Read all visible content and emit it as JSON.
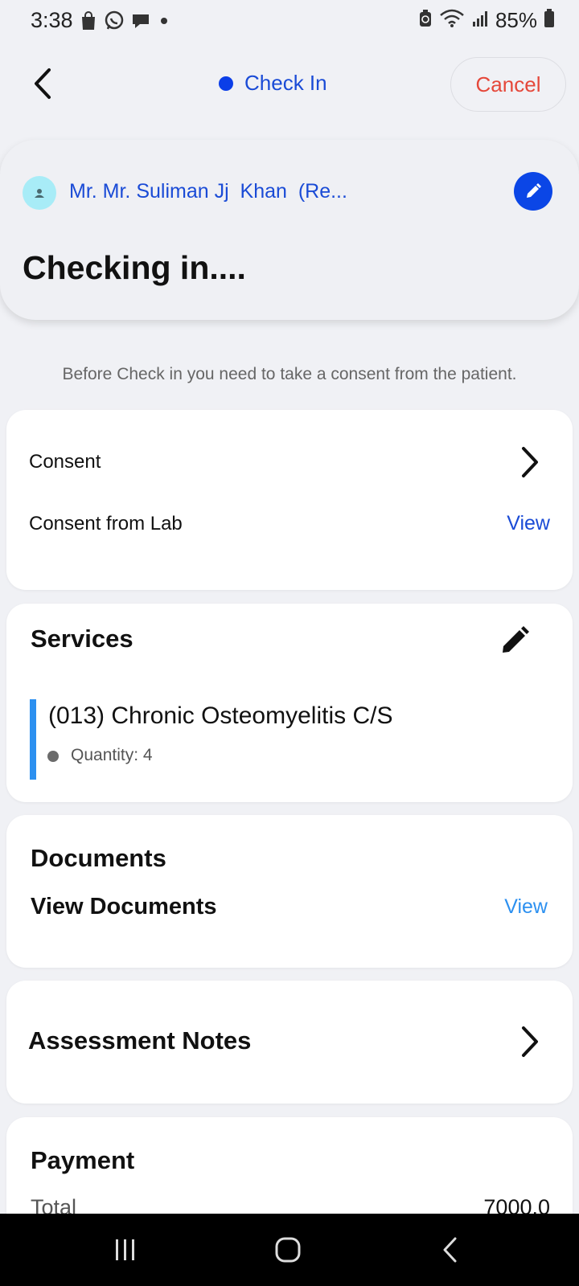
{
  "status_bar": {
    "time": "3:38",
    "battery": "85%",
    "left_icons": [
      "shopping-bag-icon",
      "whatsapp-icon",
      "chat-icon",
      "dot-icon"
    ],
    "right_icons": [
      "battery-saver-icon",
      "wifi-icon",
      "signal-icon",
      "battery-icon"
    ]
  },
  "header": {
    "title": "Check In",
    "status_dot_color": "#0b3ee8",
    "cancel_label": "Cancel"
  },
  "patient": {
    "name": "Mr. Mr. Suliman Jj  Khan  (Re...",
    "heading": "Checking in...."
  },
  "consent_hint": "Before Check in you need to take a consent from the patient.",
  "consent": {
    "consent_label": "Consent",
    "lab_label": "Consent from Lab",
    "lab_view": "View"
  },
  "services": {
    "title": "Services",
    "items": [
      {
        "name": "(013) Chronic Osteomyelitis C/S",
        "quantity": "Quantity: 4"
      }
    ],
    "accent_color": "#2c90f0"
  },
  "documents": {
    "title": "Documents",
    "sub": "View Documents",
    "view": "View"
  },
  "assessment": {
    "title": "Assessment Notes"
  },
  "payment": {
    "title": "Payment",
    "total_label": "Total",
    "total_value": "7000.0"
  },
  "colors": {
    "primary": "#1a4bd6",
    "cancel": "#e5483a",
    "background": "#f0f1f5"
  }
}
